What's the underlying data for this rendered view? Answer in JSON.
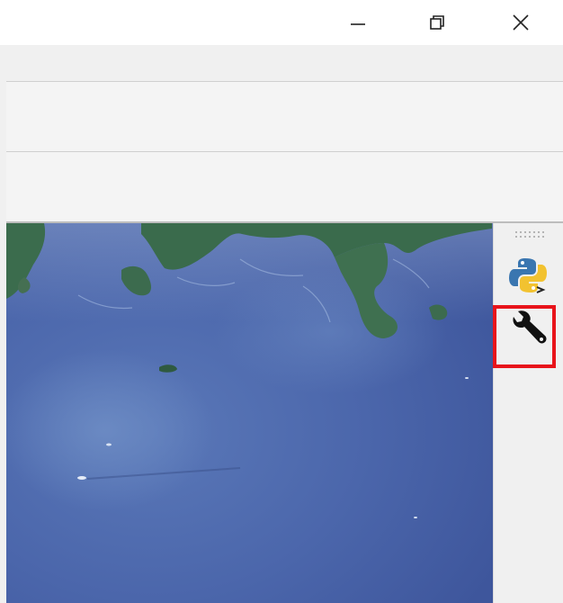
{
  "window": {
    "controls": {
      "minimize_icon": "minimize-icon",
      "restore_icon": "restore-icon",
      "close_icon": "close-icon"
    }
  },
  "plugins_toolbar": {
    "items": [
      {
        "id": "python-console",
        "icon": "python-console-icon"
      },
      {
        "id": "processing-toolbox",
        "icon": "wrench-icon",
        "highlighted": true
      }
    ]
  },
  "colors": {
    "highlight_border": "#e8141b",
    "sea": "#4a63a8",
    "land": "#3a6b4c"
  }
}
